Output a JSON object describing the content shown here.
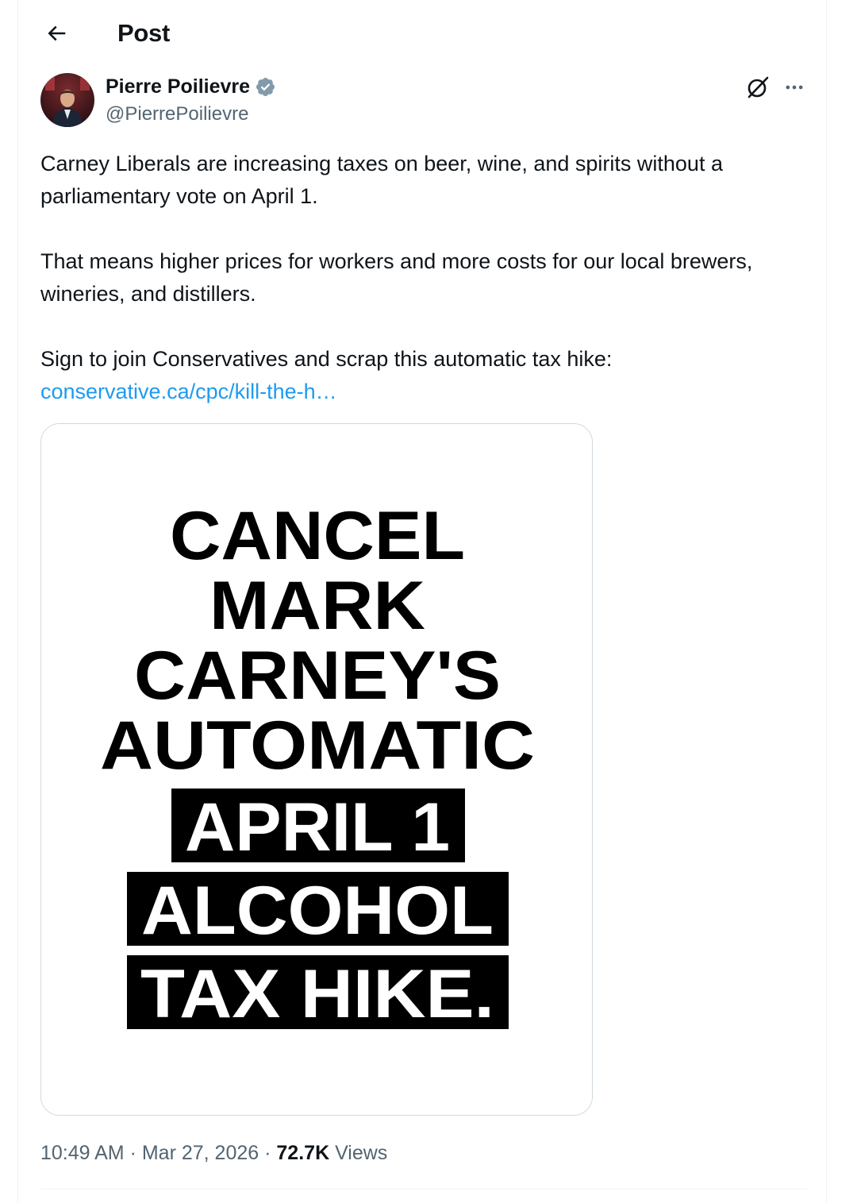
{
  "header": {
    "title": "Post",
    "back_icon": "arrow-left-icon"
  },
  "author": {
    "name": "Pierre Poilievre",
    "handle": "@PierrePoilievre",
    "verified_icon": "verified-badge-icon",
    "verified_color": "#829aab"
  },
  "actions": {
    "grok_icon": "grok-icon",
    "more_icon": "more-dots-icon"
  },
  "tweet": {
    "paragraph_1": "Carney Liberals are increasing taxes on beer, wine, and spirits without a parliamentary vote on April 1.",
    "paragraph_2": "That means higher prices for workers and more costs for our local brewers, wineries, and distillers.",
    "paragraph_3": "Sign to join Conservatives and scrap this automatic tax hike:",
    "link_text": "conservative.ca/cpc/kill-the-h…",
    "link_color": "#1d9bf0"
  },
  "media": {
    "lines_plain": [
      "CANCEL",
      "MARK",
      "CARNEY'S",
      "AUTOMATIC"
    ],
    "lines_boxed": [
      "APRIL 1",
      "ALCOHOL",
      "TAX HIKE."
    ]
  },
  "meta": {
    "time": "10:49 AM",
    "separator": " · ",
    "date": "Mar 27, 2026",
    "views_count": "72.7K",
    "views_label": " Views"
  }
}
